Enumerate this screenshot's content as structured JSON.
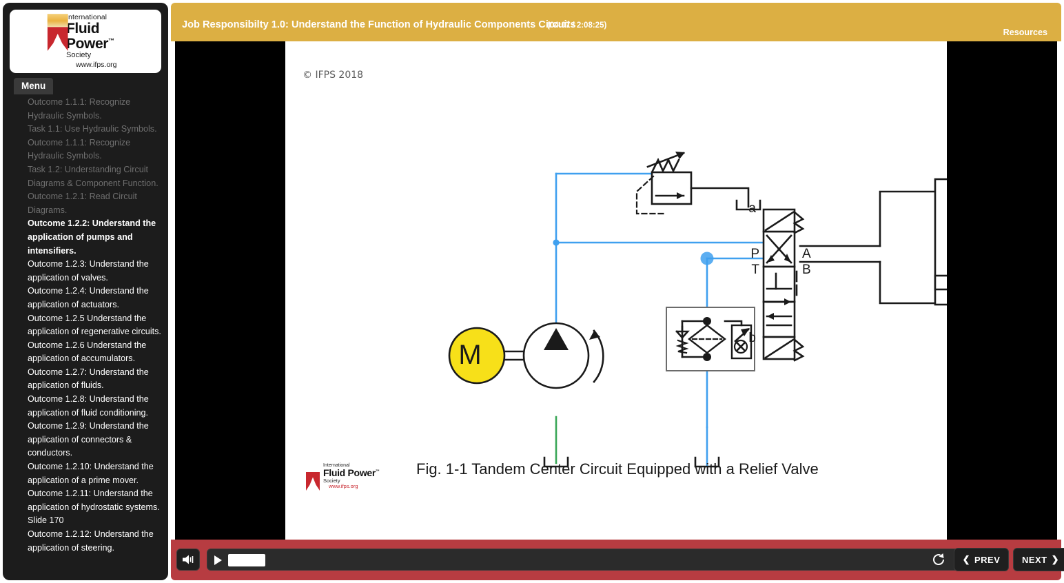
{
  "sidebar": {
    "logo": {
      "line1": "International",
      "line2": "Fluid Power",
      "tm": "™",
      "line3": "Society",
      "line4": "www.ifps.org"
    },
    "menu_tab_label": "Menu",
    "items": [
      {
        "label": "Outcome 1.1.1: Recognize Hydraulic Symbols.",
        "state": "visited"
      },
      {
        "label": "Task 1.1: Use Hydraulic Symbols.",
        "state": "visited"
      },
      {
        "label": "Outcome 1.1.1: Recognize Hydraulic Symbols.",
        "state": "visited"
      },
      {
        "label": "Task 1.2: Understanding Circuit Diagrams & Component Function.",
        "state": "visited"
      },
      {
        "label": "Outcome 1.2.1: Read Circuit Diagrams.",
        "state": "visited"
      },
      {
        "label": "Outcome 1.2.2: Understand the application of pumps and intensifiers.",
        "state": "current"
      },
      {
        "label": "Outcome 1.2.3: Understand the application of valves.",
        "state": "normal"
      },
      {
        "label": "Outcome 1.2.4: Understand the application of actuators.",
        "state": "normal"
      },
      {
        "label": "Outcome 1.2.5 Understand the application of regenerative circuits.",
        "state": "normal"
      },
      {
        "label": "Outcome 1.2.6 Understand the application of accumulators.",
        "state": "normal"
      },
      {
        "label": "Outcome 1.2.7: Understand the application of fluids.",
        "state": "normal"
      },
      {
        "label": "Outcome 1.2.8: Understand the application of fluid conditioning.",
        "state": "normal"
      },
      {
        "label": "Outcome 1.2.9: Understand the application of connectors & conductors.",
        "state": "normal"
      },
      {
        "label": "Outcome 1.2.10: Understand the application of a prime mover.",
        "state": "normal"
      },
      {
        "label": "Outcome 1.2.11: Understand the application of hydrostatic systems.",
        "state": "normal"
      },
      {
        "label": "Slide 170",
        "state": "normal"
      },
      {
        "label": "Outcome 1.2.12: Understand the application of steering.",
        "state": "normal"
      }
    ]
  },
  "header": {
    "title": "Job Responsibilty 1.0: Understand the Function of Hydraulic Components Circuits",
    "time": "(04:07 / 2:08:25)",
    "resources_label": "Resources",
    "background_color": "#dcaf43"
  },
  "slide": {
    "copyright": "© IFPS 2018",
    "caption": "Fig. 1-1 Tandem Center Circuit Equipped with a Relief Valve",
    "logo": {
      "line1": "International",
      "line2": "Fluid Power",
      "tm": "™",
      "line3": "Society",
      "line4": "www.ifps.org"
    },
    "diagram": {
      "title": "Tandem Center Circuit Equipped with a Relief Valve",
      "labels": {
        "motor": "M",
        "dcv_solenoid_a": "a",
        "dcv_solenoid_b": "b",
        "port_p": "P",
        "port_t": "T",
        "port_a": "A",
        "port_b": "B"
      },
      "colors": {
        "pressure_line": "#3fa0ef",
        "suction_line": "#3aa757",
        "motor_fill": "#f7e019",
        "symbol_stroke": "#1a1a1a"
      },
      "components": [
        "electric-motor",
        "fixed-displacement-pump",
        "pressure-relief-valve",
        "tandem-center-4way-3position-dcv",
        "double-acting-cylinder",
        "return-line-filter-with-bypass-and-indicator",
        "reservoir"
      ]
    }
  },
  "controls": {
    "volume_icon": "speaker-icon",
    "play_icon": "play-icon",
    "replay_icon": "replay-icon",
    "prev_label": "PREV",
    "next_label": "NEXT",
    "prev_chevron": "❮",
    "next_chevron": "❯",
    "progress_percent": 5,
    "background_color": "#b73c41"
  }
}
